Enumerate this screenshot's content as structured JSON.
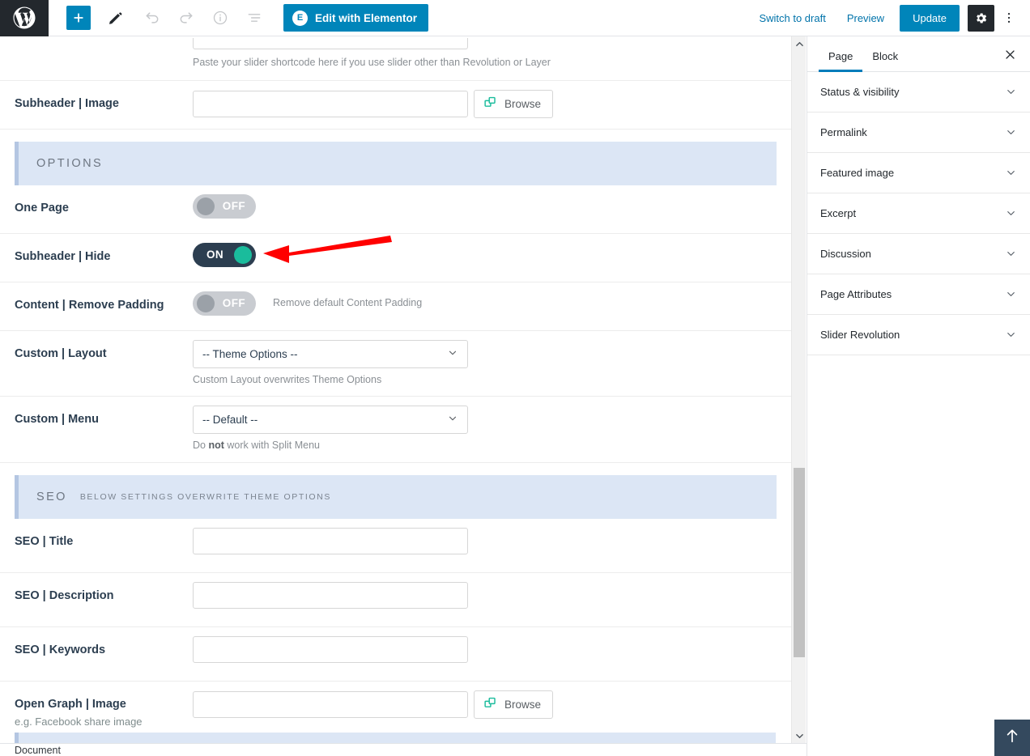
{
  "toolbar": {
    "logo_icon": "wordpress-logo-icon",
    "add_block_label": "+",
    "add_block_icon": "plus-icon",
    "edit_icon": "pencil-icon",
    "undo_icon": "undo-icon",
    "redo_icon": "redo-icon",
    "info_icon": "info-icon",
    "outline_icon": "list-view-icon",
    "elementor_label": "Edit with Elementor",
    "elementor_badge": "E",
    "switch_to_draft_label": "Switch to draft",
    "preview_label": "Preview",
    "update_label": "Update",
    "settings_icon": "gear-icon",
    "more_icon": "more-vertical-icon",
    "accent_color": "#0085ba",
    "dark_color": "#23282d"
  },
  "main": {
    "shortcode_help": "Paste your slider shortcode here if you use slider other than Revolution or Layer",
    "rows": [
      {
        "label": "Subheader | Image",
        "sublabel": "",
        "type": "text-browse",
        "value": "",
        "browse_label": "Browse",
        "browse_icon": "browse-media-icon",
        "help": ""
      }
    ],
    "options_section": {
      "title": "OPTIONS",
      "subtitle": ""
    },
    "seo_section": {
      "title": "SEO",
      "subtitle": "BELOW SETTINGS OVERWRITE THEME OPTIONS"
    },
    "one_page": {
      "label": "One Page",
      "state": "OFF",
      "help": ""
    },
    "subheader_hide": {
      "label": "Subheader | Hide",
      "state": "ON",
      "help": ""
    },
    "content_remove_padding": {
      "label": "Content | Remove Padding",
      "state": "OFF",
      "help": "Remove default Content Padding"
    },
    "custom_layout": {
      "label": "Custom | Layout",
      "value": "-- Theme Options --",
      "help": "Custom Layout overwrites Theme Options",
      "options": [
        "-- Theme Options --"
      ]
    },
    "custom_menu": {
      "label": "Custom | Menu",
      "value": "-- Default --",
      "help_prefix": "Do ",
      "help_bold": "not",
      "help_suffix": " work with Split Menu",
      "options": [
        "-- Default --"
      ]
    },
    "seo_title": {
      "label": "SEO | Title",
      "value": ""
    },
    "seo_description": {
      "label": "SEO | Description",
      "value": ""
    },
    "seo_keywords": {
      "label": "SEO | Keywords",
      "value": ""
    },
    "open_graph_image": {
      "label": "Open Graph | Image",
      "sublabel": "e.g. Facebook share image",
      "value": "",
      "browse_label": "Browse"
    },
    "section_bg": "#dce6f5",
    "section_accent": "#b4c6e2",
    "toggle_on_bg": "#2c3e50",
    "toggle_on_knob": "#1abc9c",
    "toggle_off_bg": "#c9ccd1"
  },
  "sidebar": {
    "tabs": [
      {
        "label": "Page",
        "active": true
      },
      {
        "label": "Block",
        "active": false
      }
    ],
    "close_icon": "close-icon",
    "panels": [
      {
        "label": "Status & visibility",
        "icon": "chevron-down-icon"
      },
      {
        "label": "Permalink",
        "icon": "chevron-down-icon"
      },
      {
        "label": "Featured image",
        "icon": "chevron-down-icon"
      },
      {
        "label": "Excerpt",
        "icon": "chevron-down-icon"
      },
      {
        "label": "Discussion",
        "icon": "chevron-down-icon"
      },
      {
        "label": "Page Attributes",
        "icon": "chevron-down-icon"
      },
      {
        "label": "Slider Revolution",
        "icon": "chevron-down-icon"
      }
    ]
  },
  "statusbar": {
    "breadcrumb": "Document"
  },
  "scroll_top_button": {
    "icon": "arrow-up-icon",
    "color": "#34495e"
  },
  "annotation": {
    "type": "red-arrow",
    "color": "#ff0000",
    "points_to": "Subheader | Hide toggle"
  },
  "scrollbar": {
    "up_icon": "scroll-up-icon",
    "down_icon": "scroll-down-icon"
  }
}
